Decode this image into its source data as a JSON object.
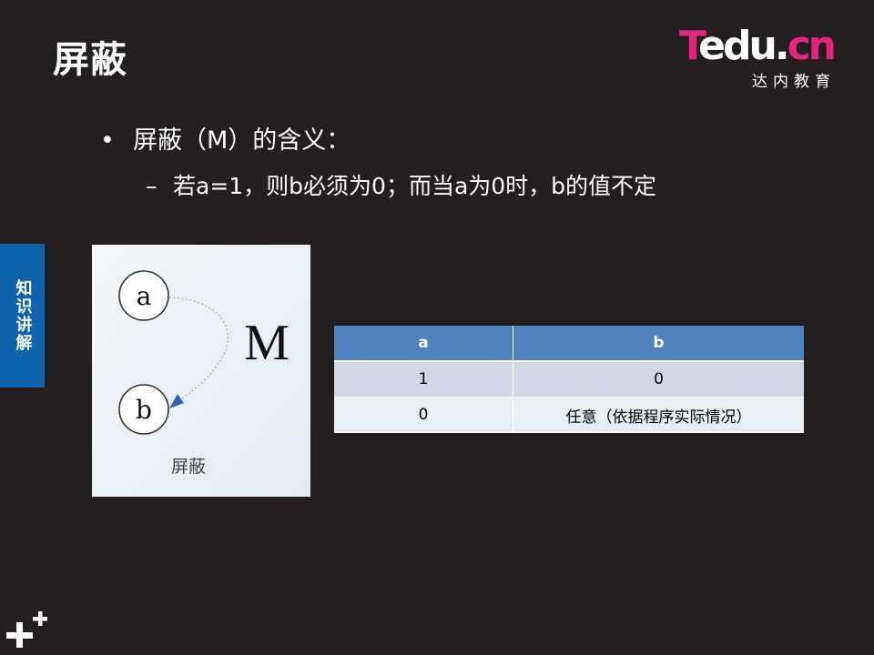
{
  "slide": {
    "title": "屏蔽",
    "bullet_main": "屏蔽（M）的含义：",
    "bullet_sub": "若a=1，则b必须为0；而当a为0时，b的值不定"
  },
  "logo": {
    "word_t": "T",
    "word_edu": "edu.",
    "word_cn": "cn",
    "subtitle": "达内教育",
    "brand_color": "#e6237e"
  },
  "side_tab": {
    "label": "知识讲解",
    "color": "#0d63ad"
  },
  "diagram": {
    "node_a": "a",
    "node_b": "b",
    "relation_letter": "M",
    "caption": "屏蔽"
  },
  "table": {
    "headers": [
      "a",
      "b"
    ],
    "rows": [
      [
        "1",
        "0"
      ],
      [
        "0",
        "任意（依据程序实际情况）"
      ]
    ],
    "header_color": "#4f81bd"
  }
}
